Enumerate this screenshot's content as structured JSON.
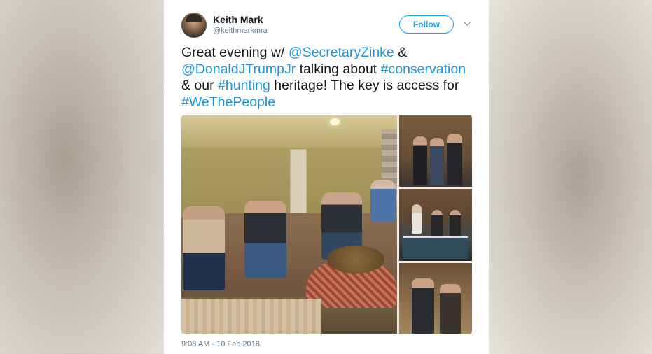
{
  "tweet": {
    "author_name": "Keith Mark",
    "author_handle": "@keithmarkmra",
    "follow_label": "Follow",
    "text_parts": {
      "p1": "Great evening w/ ",
      "m1": "@SecretaryZinke",
      "p2": " & ",
      "m2": "@DonaldJTrumpJr",
      "p3": " talking about ",
      "h1": "#conservation",
      "p4": " & our ",
      "h2": "#hunting",
      "p5": " heritage! The key is access for ",
      "h3": "#WeThePeople"
    },
    "timestamp": "9:08 AM - 10 Feb 2018"
  },
  "colors": {
    "link": "#1b95e0",
    "follow_accent": "#1da1f2",
    "secondary_text": "#657786"
  },
  "icons": {
    "more_menu": "chevron-down-icon"
  }
}
